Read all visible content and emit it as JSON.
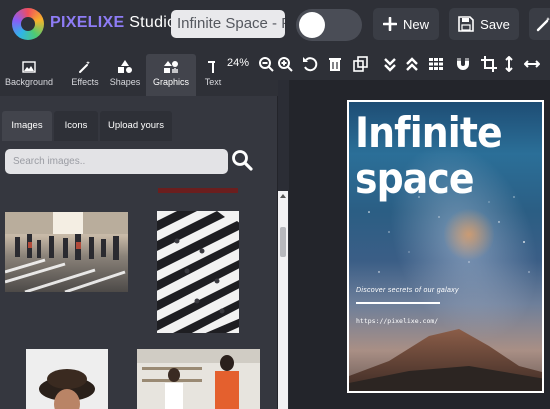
{
  "app": {
    "brand_name": "PIXELIXE",
    "brand_suffix": "Studio",
    "document_title": "Infinite Space - P",
    "accent": "#8e7cf6"
  },
  "topbar": {
    "new_label": "New",
    "save_label": "Save",
    "new_icon": "plus-icon",
    "save_icon": "floppy-disk-icon",
    "magic_icon": "magic-wand-icon"
  },
  "panel_tabs": [
    {
      "label": "Background",
      "icon": "image-icon"
    },
    {
      "label": "Effects",
      "icon": "magic-wand-icon"
    },
    {
      "label": "Shapes",
      "icon": "shapes-icon"
    },
    {
      "label": "Graphics",
      "icon": "graphics-icon",
      "active": true
    },
    {
      "label": "Text",
      "icon": "text-icon"
    }
  ],
  "graphics_tabs": [
    {
      "label": "Images",
      "active": true
    },
    {
      "label": "Icons"
    },
    {
      "label": "Upload yours"
    }
  ],
  "search": {
    "placeholder": "Search images.."
  },
  "toolbar": {
    "zoom": "24%"
  },
  "poster": {
    "title_line1": "Infinite",
    "title_line2": "space",
    "subtitle": "Discover secrets of our galaxy",
    "url": "https://pixelixe.com/"
  }
}
